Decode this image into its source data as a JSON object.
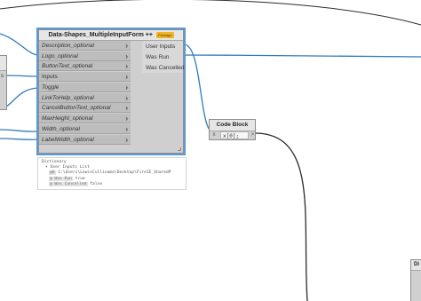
{
  "main_node": {
    "title": "Data-Shapes_MultipleInputForm ++",
    "badge": "Package",
    "inputs": [
      {
        "label": "Description_optional",
        "optional": true
      },
      {
        "label": "Logo_optional",
        "optional": true
      },
      {
        "label": "ButtonText_optional",
        "optional": true
      },
      {
        "label": "Inputs",
        "optional": false
      },
      {
        "label": "Toggle",
        "optional": false
      },
      {
        "label": "LinkToHelp_optional",
        "optional": true
      },
      {
        "label": "CancelButtonText_optional",
        "optional": true
      },
      {
        "label": "MaxHeight_optional",
        "optional": true
      },
      {
        "label": "Width_optional",
        "optional": true
      },
      {
        "label": "LabelWidth_optional",
        "optional": true
      }
    ],
    "chevron": "›",
    "outputs": [
      "User Inputs",
      "Was Run",
      "Was Cancelled"
    ]
  },
  "preview": {
    "title": "Dictionary",
    "rows": [
      {
        "prefix": "User Inputs",
        "index": "",
        "text": "List"
      },
      {
        "prefix": "",
        "index": "@0",
        "text": "C:\\Users\\LewisCulliname\\Desktop\\FireIE_SharedP"
      },
      {
        "prefix": "",
        "index": "@ Was Run",
        "text": "true"
      },
      {
        "prefix": "",
        "index": "@ Was Cancelled",
        "text": "false"
      }
    ]
  },
  "code_block": {
    "title": "Code Block",
    "input_port": "x",
    "code": "x[0];",
    "output_port": ">"
  },
  "left_partial": {
    "label": "s"
  },
  "right_partial": {
    "title": "Di"
  },
  "colors": {
    "canvas": "#ffffff",
    "node_body": "#cfcfcf",
    "node_header": "#e6e6e6",
    "selection": "#5b9bd5",
    "wire_blue": "#2f7bbd",
    "wire_dark": "#2b2b2b",
    "badge": "#f0b429"
  }
}
